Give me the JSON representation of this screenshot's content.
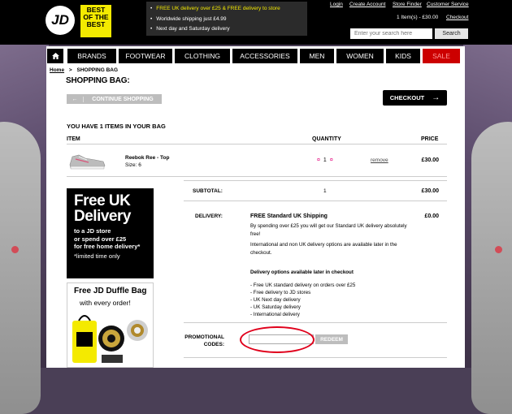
{
  "header": {
    "logo_text": "JD",
    "badge_text": [
      "BEST",
      "OF THE",
      "BEST"
    ],
    "promos": [
      "FREE UK delivery over £25 & FREE delivery to store",
      "Worldwide shipping just £4.99",
      "Next day and Saturday delivery"
    ],
    "links": [
      "Login",
      "Create Account",
      "Store Finder",
      "Customer Service"
    ],
    "bag_info": "1 Item(s) - £30.00",
    "checkout_link": "Checkout",
    "search_placeholder": "Enter your search here",
    "search_button": "Search"
  },
  "nav": {
    "items": [
      "BRANDS",
      "FOOTWEAR",
      "CLOTHING",
      "ACCESSORIES",
      "MEN",
      "WOMEN",
      "KIDS",
      "SALE"
    ]
  },
  "breadcrumb": {
    "home": "Home",
    "sep": ">",
    "current": "SHOPPING BAG"
  },
  "page_title": "SHOPPING BAG:",
  "buttons": {
    "continue_arrow": "←",
    "continue": "CONTINUE SHOPPING",
    "checkout": "CHECKOUT",
    "checkout_arrow": "→"
  },
  "bag": {
    "items_count_text": "YOU HAVE 1 ITEMS IN YOUR BAG",
    "columns": {
      "item": "ITEM",
      "quantity": "QUANTITY",
      "price": "PRICE"
    },
    "items": [
      {
        "name": "Reebok Ree - Top",
        "size": "Size: 6",
        "qty_minus": "¤",
        "quantity": "1",
        "qty_plus": "¤",
        "remove": "remove",
        "price": "£30.00"
      }
    ]
  },
  "banner_free_delivery": {
    "line1": "Free UK",
    "line2": "Delivery",
    "sub": [
      "to a JD store",
      "or spend over £25",
      "for free home delivery*"
    ],
    "limited": "*limited time only"
  },
  "banner_duffle": {
    "title": "Free JD Duffle Bag",
    "sub": "with every order!"
  },
  "summary": {
    "subtotal_label": "SUBTOTAL:",
    "subtotal_qty": "1",
    "subtotal_value": "£30.00",
    "delivery_label": "DELIVERY:",
    "delivery_title": "FREE Standard UK Shipping",
    "delivery_value": "£0.00",
    "delivery_text1": "By spending over £25 you will get our Standard UK delivery absolutely free!",
    "delivery_text2": "International and non UK delivery options are available later in the checkout.",
    "later_title": "Delivery options available later in checkout",
    "later_options": [
      "- Free UK standard delivery on orders over £25",
      "- Free delivery to JD stores",
      "- UK Next day delivery",
      "- UK Saturday delivery",
      "- International delivery"
    ]
  },
  "promo": {
    "label_line1": "PROMOTIONAL",
    "label_line2": "CODES:",
    "input_value": "",
    "redeem": "REDEEM"
  },
  "colors": {
    "accent_yellow": "#f4ea00",
    "sale_red": "#cc0000",
    "annotation_red": "#e0001b",
    "qty_pink": "#e3007a"
  }
}
